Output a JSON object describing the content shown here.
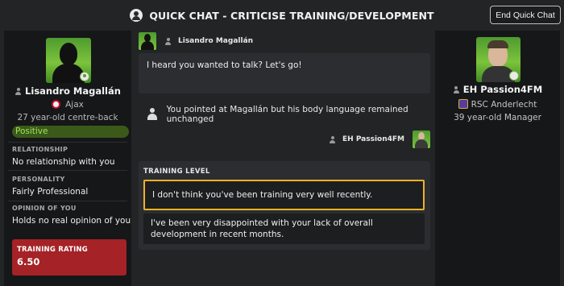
{
  "header": {
    "title": "QUICK CHAT - CRITICISE TRAINING/DEVELOPMENT",
    "end_button_label": "End Quick Chat",
    "title_icon": "person-icon"
  },
  "player": {
    "name": "Lisandro Magallán",
    "club": "Ajax",
    "age_position": "27 year-old centre-back",
    "mood": "Positive",
    "sections": [
      {
        "label": "RELATIONSHIP",
        "value": "No relationship with you"
      },
      {
        "label": "PERSONALITY",
        "value": "Fairly Professional"
      },
      {
        "label": "OPINION OF YOU",
        "value": "Holds no real opinion of you"
      }
    ],
    "rating_label": "TRAINING RATING",
    "rating_value": "6.50"
  },
  "conversation": {
    "player_sender": "Lisandro Magallán",
    "player_message": "I heard you wanted to talk? Let's go!",
    "event_text": "You pointed at Magallán but his body language remained unchanged",
    "manager_sender": "EH Passion4FM"
  },
  "options": {
    "title": "TRAINING LEVEL",
    "items": [
      {
        "text": "I don't think you've been training very well recently.",
        "selected": true
      },
      {
        "text": "I've been very disappointed with your lack of overall development in recent months.",
        "selected": false
      }
    ]
  },
  "manager": {
    "name": "EH Passion4FM",
    "club": "RSC Anderlecht",
    "age_role": "39 year-old Manager"
  },
  "colors": {
    "background": "#222426",
    "panel": "#161718",
    "positive_text": "#9fe35a",
    "positive_bg": "#3b5a1a",
    "rating_bg": "#a52226",
    "selected_border": "#f0b323"
  }
}
